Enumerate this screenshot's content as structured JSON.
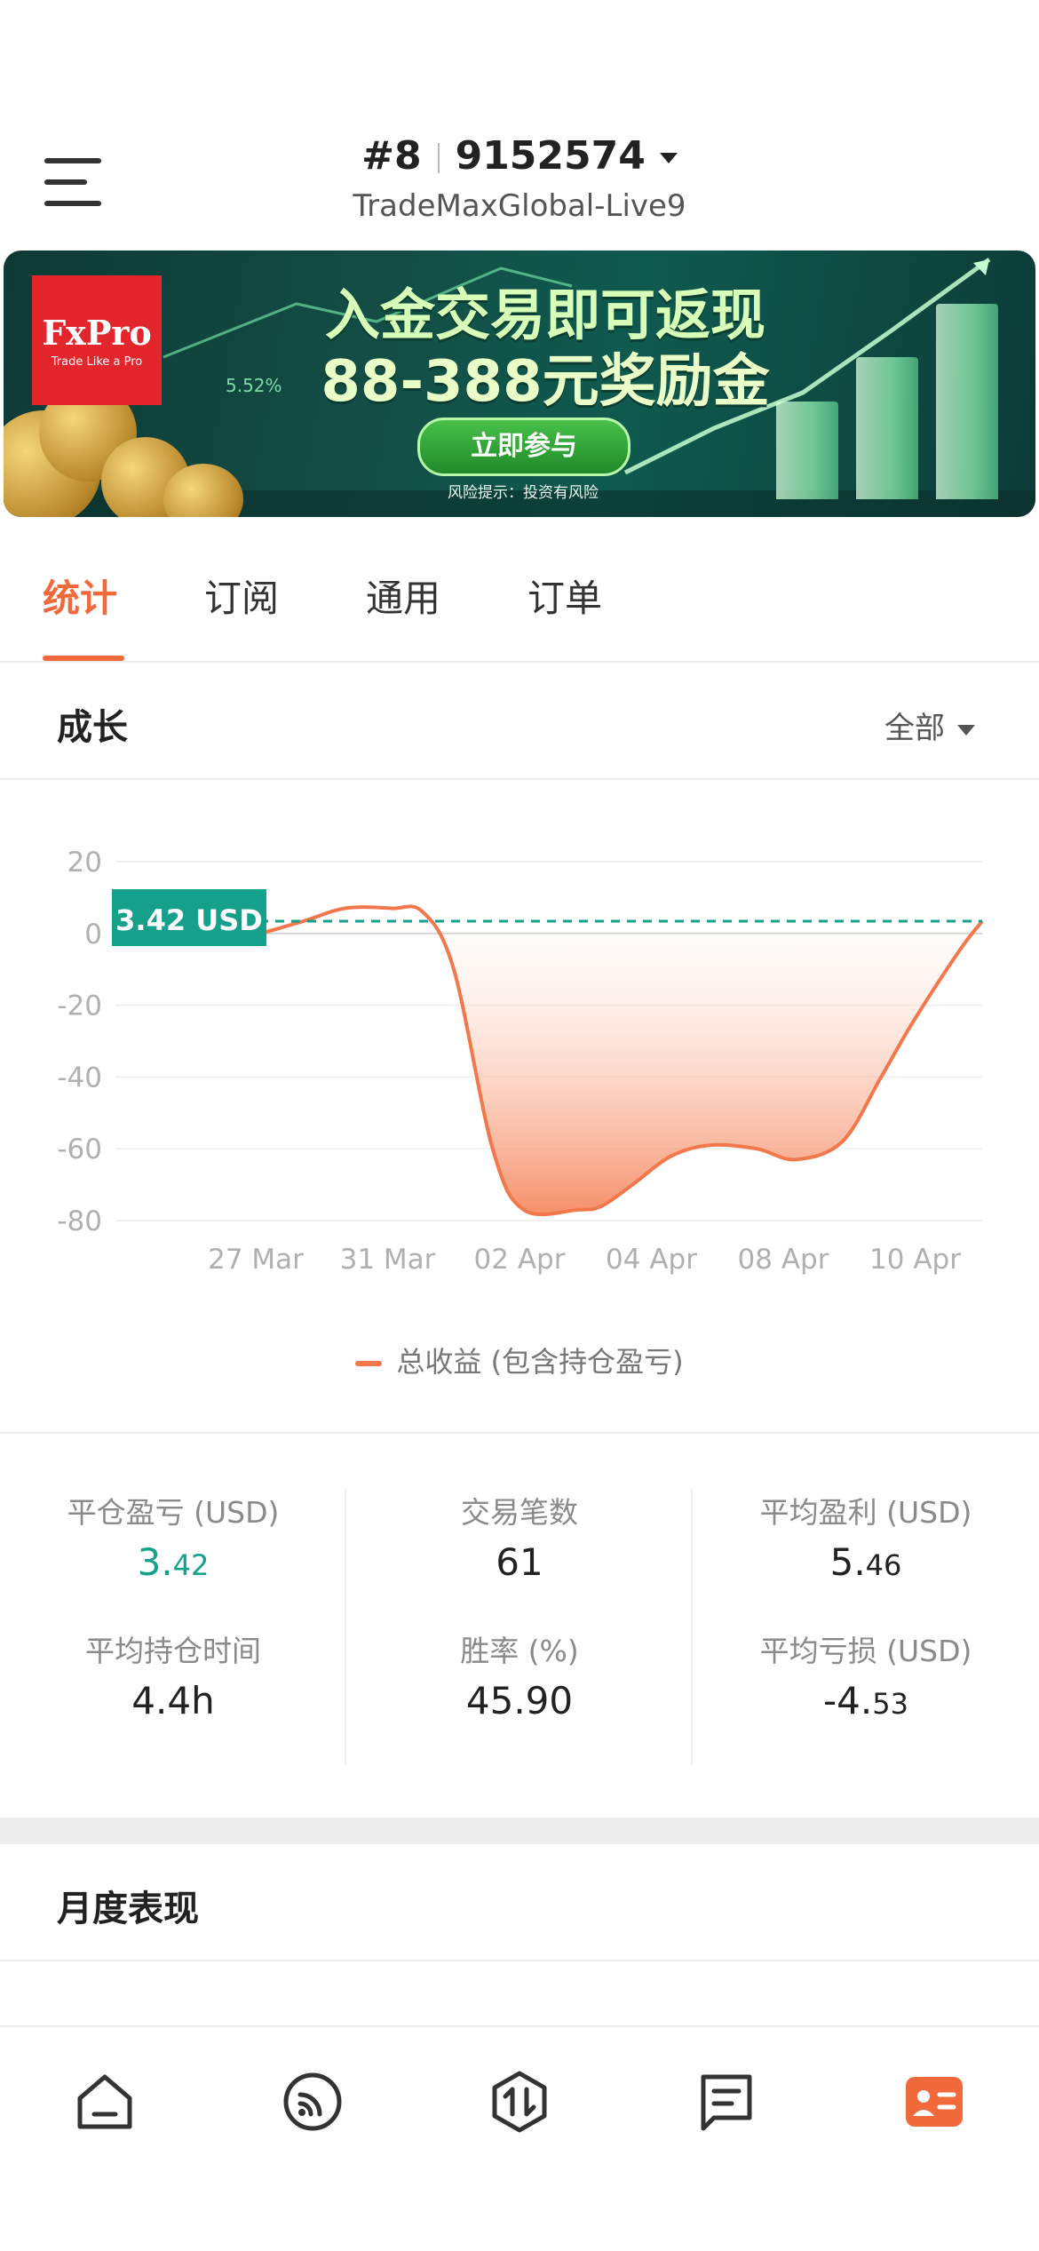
{
  "header": {
    "account_rank": "#8",
    "account_number": "9152574",
    "server": "TradeMaxGlobal-Live9"
  },
  "banner": {
    "logo_brand": "FxPro",
    "logo_tagline": "Trade Like a Pro",
    "headline": "入金交易即可返现",
    "subline": "88-388元奖励金",
    "percent_text": "5.52%",
    "cta_label": "立即参与",
    "risk_note": "风险提示：投资有风险"
  },
  "tabs": [
    {
      "label": "统计",
      "active": true
    },
    {
      "label": "订阅",
      "active": false
    },
    {
      "label": "通用",
      "active": false
    },
    {
      "label": "订单",
      "active": false
    }
  ],
  "growth": {
    "title": "成长",
    "filter_label": "全部",
    "current_label": "3.42 USD",
    "legend_label": "总收益 (包含持仓盈亏)"
  },
  "chart_data": {
    "type": "area",
    "title": "",
    "xlabel": "",
    "ylabel": "",
    "ylim": [
      -80,
      20
    ],
    "yticks": [
      20,
      0,
      -20,
      -40,
      -60,
      -80
    ],
    "xticks": [
      "27 Mar",
      "31 Mar",
      "02 Apr",
      "04 Apr",
      "08 Apr",
      "10 Apr"
    ],
    "series": [
      {
        "name": "总收益 (包含持仓盈亏)",
        "color": "#f2784b",
        "points": [
          {
            "x": 0.0,
            "y": -3
          },
          {
            "x": 0.8,
            "y": -1
          },
          {
            "x": 1.2,
            "y": 3
          },
          {
            "x": 1.5,
            "y": 7
          },
          {
            "x": 1.8,
            "y": 7
          },
          {
            "x": 2.0,
            "y": 6
          },
          {
            "x": 2.2,
            "y": -10
          },
          {
            "x": 2.45,
            "y": -60
          },
          {
            "x": 2.65,
            "y": -77
          },
          {
            "x": 3.0,
            "y": -77
          },
          {
            "x": 3.15,
            "y": -76
          },
          {
            "x": 3.35,
            "y": -70
          },
          {
            "x": 3.6,
            "y": -62
          },
          {
            "x": 3.85,
            "y": -59
          },
          {
            "x": 4.15,
            "y": -60
          },
          {
            "x": 4.4,
            "y": -63
          },
          {
            "x": 4.7,
            "y": -58
          },
          {
            "x": 4.95,
            "y": -40
          },
          {
            "x": 5.15,
            "y": -25
          },
          {
            "x": 5.45,
            "y": -5
          },
          {
            "x": 5.6,
            "y": 3.42
          }
        ]
      }
    ],
    "reference_line": {
      "y": 3.42,
      "color": "#14a08a"
    },
    "grid": true,
    "legend_position": "bottom"
  },
  "stats": {
    "closed_pl": {
      "label": "平仓盈亏 (USD)",
      "int": "3.",
      "dec": "42"
    },
    "trades": {
      "label": "交易笔数",
      "value": "61"
    },
    "avg_profit": {
      "label": "平均盈利 (USD)",
      "int": "5.",
      "dec": "46"
    },
    "avg_hold": {
      "label": "平均持仓时间",
      "value": "4.4h"
    },
    "win_rate": {
      "label": "胜率 (%)",
      "value": "45.90"
    },
    "avg_loss": {
      "label": "平均亏损 (USD)",
      "int": "-4.",
      "dec": "53"
    }
  },
  "monthly": {
    "title": "月度表现"
  },
  "colors": {
    "accent": "#f26a3b",
    "positive": "#14a08a",
    "line": "#f2784b"
  },
  "bottom_nav": [
    {
      "icon": "home-icon",
      "active": false
    },
    {
      "icon": "signal-feed-icon",
      "active": false
    },
    {
      "icon": "trade-icon",
      "active": false
    },
    {
      "icon": "message-icon",
      "active": false
    },
    {
      "icon": "profile-card-icon",
      "active": true
    }
  ]
}
